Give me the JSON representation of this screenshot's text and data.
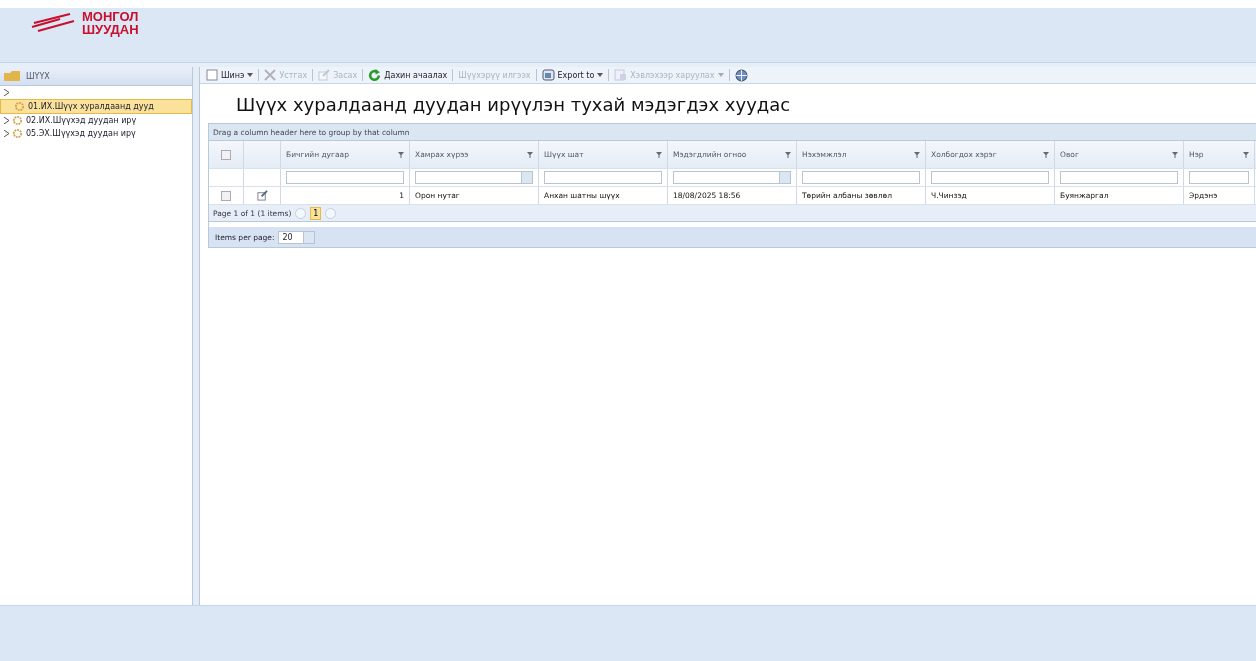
{
  "header": {
    "logo_line_1": "МОНГОЛ",
    "logo_line_2": "ШУУДАН"
  },
  "sidebar": {
    "title": "ШҮҮХ",
    "items": [
      {
        "selected": false,
        "expandable": true,
        "icon": false
      },
      {
        "label": "01.ИХ.Шүүх хуралдаанд дууд",
        "selected": true,
        "expandable": false,
        "icon": true
      },
      {
        "label": "02.ИХ.Шүүхэд дуудан ирү",
        "selected": false,
        "expandable": true,
        "icon": true
      },
      {
        "label": "05.ЭХ.Шүүхэд дуудан ирү",
        "selected": false,
        "expandable": true,
        "icon": true
      }
    ]
  },
  "toolbar": [
    {
      "kind": "new",
      "label": "Шинэ",
      "disabled": false,
      "dropdown": true
    },
    {
      "kind": "delete",
      "label": "Устгах",
      "disabled": true,
      "dropdown": false
    },
    {
      "kind": "edit",
      "label": "Засах",
      "disabled": true,
      "dropdown": false
    },
    {
      "kind": "reload",
      "label": "Дахин ачаалах",
      "disabled": false,
      "dropdown": false
    },
    {
      "kind": "text",
      "label": "Шүүхэрүү илгээх",
      "disabled": true,
      "dropdown": false
    },
    {
      "kind": "export",
      "label": "Export to",
      "disabled": false,
      "dropdown": true
    },
    {
      "kind": "print",
      "label": "Хэвлэхээр харуулах",
      "disabled": true,
      "dropdown": true
    },
    {
      "kind": "help",
      "disabled": false,
      "dropdown": false
    }
  ],
  "page_title": "Шүүх хуралдаанд дуудан ирүүлэн тухай мэдэгдэх хуудас",
  "grid": {
    "group_hint": "Drag a column header here to group by that column",
    "all_checked": false,
    "columns": [
      {
        "label": "Бичгийн дугаар",
        "filter_dropdown": false
      },
      {
        "label": "Хамрах хүрээ",
        "filter_dropdown": true
      },
      {
        "label": "Шүүх шат",
        "filter_dropdown": false
      },
      {
        "label": "Мэдэгдлийн огноо",
        "filter_dropdown": true
      },
      {
        "label": "Нэхэмжлэл",
        "filter_dropdown": false
      },
      {
        "label": "Холбогдох хэрэг",
        "filter_dropdown": false
      },
      {
        "label": "Овог",
        "filter_dropdown": false
      },
      {
        "label": "Нэр",
        "filter_dropdown": false
      }
    ],
    "rows": [
      {
        "checked": false,
        "cells": [
          "1",
          "Орон нутаг",
          "Анхан шатны шүүх",
          "18/08/2025 18:56",
          "Төрийн албаны зөвлөл",
          "Ч.Чинзэд",
          "Буянжаргал",
          "Эрдэнэ"
        ]
      }
    ],
    "pager": {
      "summary": "Page 1 of 1 (1 items)",
      "pages": [
        {
          "label": "1",
          "selected": true
        }
      ]
    },
    "page_size_label": "Items per page:",
    "page_size": "20"
  }
}
